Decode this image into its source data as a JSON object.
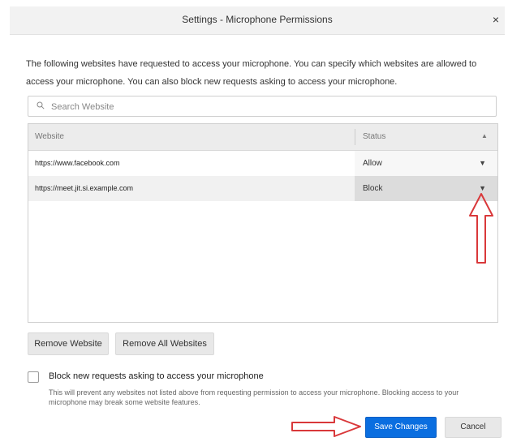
{
  "window": {
    "title": "Settings - Microphone Permissions",
    "close_glyph": "×"
  },
  "description": "The following websites have requested to access your microphone. You can specify which websites are allowed to access your microphone. You can also block new requests asking to access your microphone.",
  "search": {
    "placeholder": "Search Website",
    "value": ""
  },
  "table": {
    "columns": {
      "website": "Website",
      "status": "Status"
    },
    "sort_glyph": "▲",
    "rows": [
      {
        "website": "https://www.facebook.com",
        "status": "Allow"
      },
      {
        "website": "https://meet.jit.si.example.com",
        "status": "Block"
      }
    ],
    "dropdown_glyph": "▼"
  },
  "buttons": {
    "remove_website": "Remove Website",
    "remove_all": "Remove All Websites",
    "save": "Save Changes",
    "cancel": "Cancel"
  },
  "block_requests": {
    "checked": false,
    "label": "Block new requests asking to access your microphone",
    "description": "This will prevent any websites not listed above from requesting permission to access your microphone. Blocking access to your microphone may break some website features."
  },
  "colors": {
    "accent": "#0a6ee0",
    "annotation": "#d9383a"
  },
  "icons": {
    "search": "search-icon",
    "close": "close-icon",
    "dropdown": "chevron-down-icon",
    "annotation_up": "arrow-up-annotation",
    "annotation_right": "arrow-right-annotation"
  }
}
